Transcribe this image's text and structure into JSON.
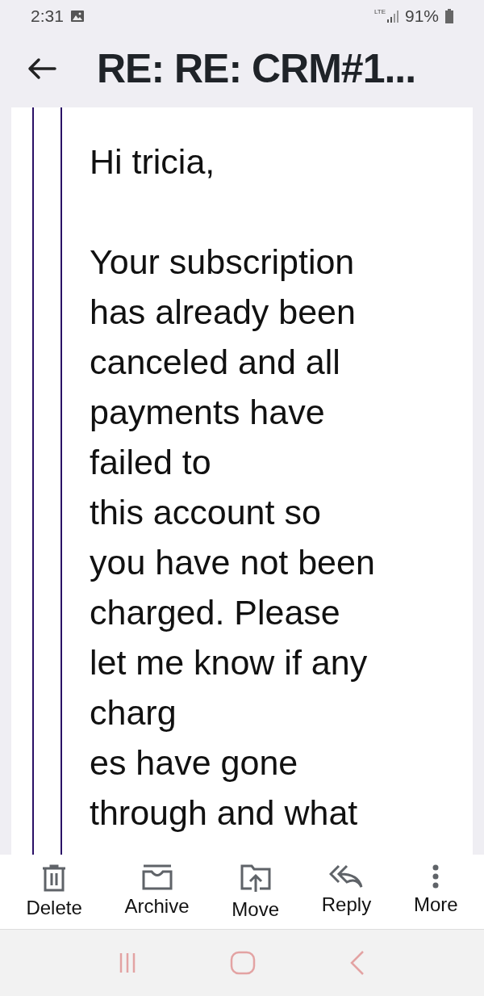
{
  "status_bar": {
    "time": "2:31",
    "network": "LTE",
    "battery": "91%"
  },
  "header": {
    "title": "RE: RE: CRM#1..."
  },
  "message": {
    "paragraphs": [
      {
        "lines": [
          "Hi tricia,"
        ]
      },
      {
        "lines": [
          "Your subscription",
          "has already been",
          "canceled and all",
          "payments have",
          "failed to",
          "this account so",
          "you have not been",
          "charged. Please",
          "let me know if any",
          "charg",
          "es have gone",
          "through and what"
        ]
      }
    ]
  },
  "toolbar": [
    {
      "kind": "delete",
      "label": "Delete"
    },
    {
      "kind": "archive",
      "label": "Archive"
    },
    {
      "kind": "move",
      "label": "Move"
    },
    {
      "kind": "reply",
      "label": "Reply"
    },
    {
      "kind": "more",
      "label": "More"
    }
  ]
}
